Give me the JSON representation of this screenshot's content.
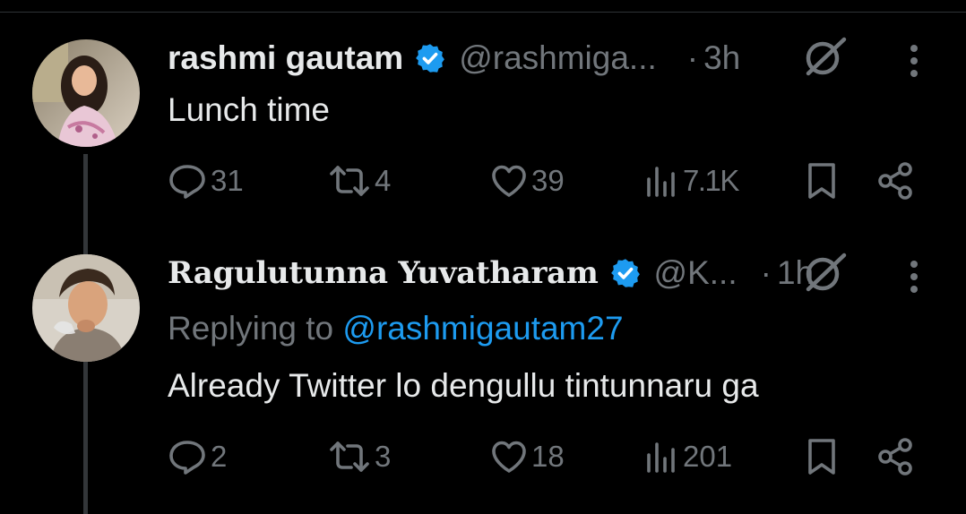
{
  "tweets": [
    {
      "name": "rashmi gautam",
      "handle": "@rashmiga...",
      "dot": "·",
      "time": "3h",
      "text": "Lunch time",
      "stats": {
        "replies": "31",
        "retweets": "4",
        "likes": "39",
        "views": "7.1K"
      }
    },
    {
      "name": "Ragulutunna Yuvatharam",
      "handle": "@K...",
      "dot": "·",
      "time": "1h",
      "replying_prefix": "Replying to ",
      "replying_handle": "@rashmigautam27",
      "text": "Already Twitter lo dengullu tintunnaru ga",
      "stats": {
        "replies": "2",
        "retweets": "3",
        "likes": "18",
        "views": "201"
      }
    }
  ],
  "colors": {
    "background": "#000000",
    "text": "#e7e9ea",
    "muted": "#71767b",
    "accent": "#1d9bf0"
  },
  "icons": [
    "verified-badge-icon",
    "grok-icon",
    "more-icon",
    "reply-icon",
    "retweet-icon",
    "like-icon",
    "views-icon",
    "bookmark-icon",
    "share-icon"
  ]
}
